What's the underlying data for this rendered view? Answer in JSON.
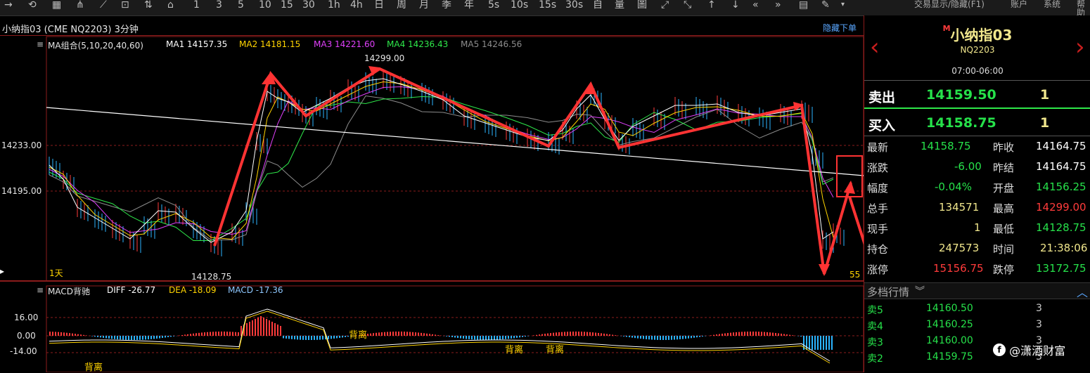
{
  "toolbar": {
    "icons": [
      "→",
      "⟲",
      "▦",
      "⋔",
      "⟋",
      "⊡",
      "⇅",
      "⌂",
      "1",
      "3",
      "5",
      "10",
      "15",
      "30",
      "1h",
      "4h",
      "日",
      "周",
      "月",
      "季",
      "年",
      "5s",
      "10s",
      "15s",
      "30s",
      "自",
      "量",
      "圖",
      "⤢",
      "⤡",
      "↑",
      "↓",
      "«",
      "»",
      "▤",
      "✎",
      "▾"
    ],
    "menu": {
      "show_hide": "交易显示/隐藏(F1)",
      "account": "账户",
      "system": "系统",
      "help": "帮助"
    }
  },
  "chart": {
    "title": "小纳指03 (CME NQ2203) 3分钟",
    "hide_menu": "隐藏下单",
    "ma_legend": {
      "label": "MA组合(5,10,20,40,60)",
      "ma1": "MA1 14157.35",
      "ma2": "MA2 14181.15",
      "ma3": "MA3 14221.60",
      "ma4": "MA4 14236.43",
      "ma5": "MA5 14246.56"
    },
    "y_labels": [
      "14233.00",
      "14195.00"
    ],
    "high_label": "14299.00",
    "low_label": "14128.75",
    "day_label": "1天",
    "right_count": "55",
    "macd_legend": {
      "label": "MACD背驰",
      "diff": "DIFF -26.77",
      "dea": "DEA -18.09",
      "macd": "MACD -17.36"
    },
    "macd_y_labels": [
      "16.00",
      "0.00",
      "-14.00"
    ],
    "divergence_labels": [
      "背离",
      "背离",
      "背离",
      "背离"
    ]
  },
  "panel": {
    "title": "小纳指03",
    "marker": "M",
    "code": "NQ2203",
    "session": "07:00-06:00",
    "sell_label": "卖出",
    "sell_price": "14159.50",
    "sell_qty": "1",
    "buy_label": "买入",
    "buy_price": "14158.75",
    "buy_qty": "1",
    "stats": [
      {
        "k1": "最新",
        "v1": "14158.75",
        "k2": "昨收",
        "v2": "14164.75",
        "c1": "#26e14a",
        "c2": "#ffffff"
      },
      {
        "k1": "涨跌",
        "v1": "-6.00",
        "k2": "昨结",
        "v2": "14164.75",
        "c1": "#26e14a",
        "c2": "#ffffff"
      },
      {
        "k1": "幅度",
        "v1": "-0.04%",
        "k2": "开盘",
        "v2": "14156.25",
        "c1": "#26e14a",
        "c2": "#26e14a"
      },
      {
        "k1": "总手",
        "v1": "134571",
        "k2": "最高",
        "v2": "14299.00",
        "c1": "#f0e68c",
        "c2": "#ff3b3b"
      },
      {
        "k1": "现手",
        "v1": "1",
        "k2": "最低",
        "v2": "14128.75",
        "c1": "#f0e68c",
        "c2": "#26e14a"
      },
      {
        "k1": "持仓",
        "v1": "247573",
        "k2": "时间",
        "v2": "21:38:06",
        "c1": "#f0e68c",
        "c2": "#f0e68c"
      },
      {
        "k1": "涨停",
        "v1": "15156.75",
        "k2": "跌停",
        "v2": "13172.75",
        "c1": "#ff3b3b",
        "c2": "#26e14a"
      }
    ],
    "depth_title": "多档行情",
    "depth": [
      {
        "side": "卖5",
        "price": "14160.50",
        "qty": "3"
      },
      {
        "side": "卖4",
        "price": "14160.25",
        "qty": "3"
      },
      {
        "side": "卖3",
        "price": "14160.00",
        "qty": "3"
      },
      {
        "side": "卖2",
        "price": "14159.75",
        "qty": "3"
      }
    ],
    "watermark": "@潇洒财富"
  },
  "colors": {
    "ma1": "#ffffff",
    "ma2": "#ffd400",
    "ma3": "#e040fb",
    "ma4": "#2ee84a",
    "ma5": "#8c8c8c",
    "up": "#ff3b3b",
    "down": "#2bb3ff",
    "arrow": "#ff3333"
  }
}
